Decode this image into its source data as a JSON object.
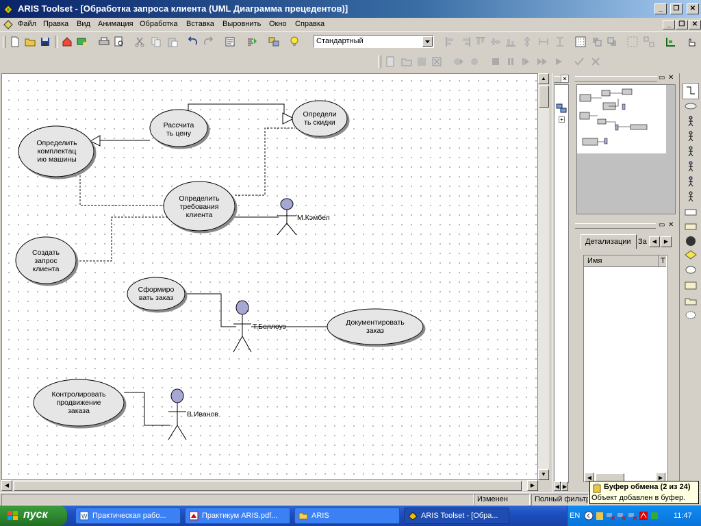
{
  "window": {
    "title": "ARIS Toolset - [Обработка запроса клиента (UML Диаграмма прецедентов)]",
    "min_glyph": "_",
    "max_glyph": "❐",
    "close_glyph": "✕"
  },
  "menu": {
    "items": [
      "Файл",
      "Правка",
      "Вид",
      "Анимация",
      "Обработка",
      "Вставка",
      "Выровнить",
      "Окно",
      "Справка"
    ]
  },
  "toolbar": {
    "style_select_value": "Стандартный"
  },
  "diagram": {
    "use_cases": [
      {
        "id": "calc-price",
        "label": "Рассчита\nть цену"
      },
      {
        "id": "discounts",
        "label": "Определи\nть скидки"
      },
      {
        "id": "config",
        "label": "Определить\nкомплектац\nию машины"
      },
      {
        "id": "requirements",
        "label": "Определить\nтребования\nклиента"
      },
      {
        "id": "create-request",
        "label": "Создать\nзапрос\nклиента"
      },
      {
        "id": "form-order",
        "label": "Сформиро\nвать заказ"
      },
      {
        "id": "document-order",
        "label": "Документировать\nзаказ"
      },
      {
        "id": "track-order",
        "label": "Контролировать\nпродвижение\nзаказа"
      }
    ],
    "actors": [
      {
        "id": "kembel",
        "name": "М.Кэмбел"
      },
      {
        "id": "bellous",
        "name": "Т.Беллоуз"
      },
      {
        "id": "ivanov",
        "name": "В.Иванов"
      }
    ]
  },
  "panels": {
    "properties_tabs": [
      "Детализации",
      "За"
    ],
    "column_name": "Имя",
    "column_type": "Т"
  },
  "status": {
    "changed": "Изменен",
    "filter": "Полный фильтр"
  },
  "tooltip": {
    "title": "Буфер обмена (2 из 24)",
    "body": "Объект добавлен в буфер."
  },
  "taskbar": {
    "start": "пуск",
    "tasks": [
      "Практическая рабо...",
      "Практикум ARIS.pdf...",
      "ARIS",
      "ARIS Toolset - [Обра..."
    ],
    "lang": "EN",
    "clock": "11:47"
  },
  "colors": {
    "titlebar": "#0a246a",
    "use_case_fill": "#e6e6e6",
    "actor_head": "#a7a7d6",
    "taskbar": "#245edb",
    "start_button": "#3c9a3c"
  }
}
